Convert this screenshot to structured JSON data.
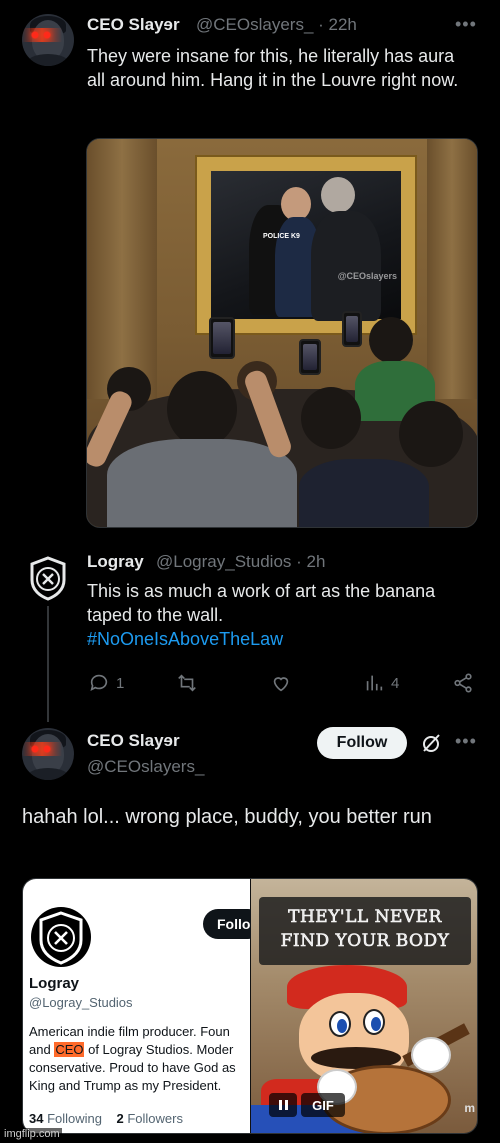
{
  "tweet1": {
    "name": "CEO Slayɘr",
    "handle": "@CEOslayers_",
    "time": "· 22h",
    "more": "•••",
    "text": "They were insane for this, he literally has aura all around him. Hang it in the Louvre right now.",
    "image": {
      "painting_police_text": "POLICE K9",
      "watermark": "@CEOslayers"
    }
  },
  "tweet2": {
    "name": "Logray",
    "handle": "@Logray_Studios",
    "time": "· 2h",
    "text_line1": "This is as much a work of art as the banana",
    "text_line2": "taped to the wall.",
    "hashtag": "#NoOneIsAboveTheLaw",
    "actions": {
      "reply_count": "1",
      "retweet_count": "",
      "like_count": "",
      "views_count": "4"
    }
  },
  "tweet3": {
    "name": "CEO Slayɘr",
    "handle": "@CEOslayers_",
    "follow_label": "Follow",
    "more": "•••",
    "text": "hahah lol... wrong place, buddy, you better run",
    "screenshot": {
      "follow_label": "Follo",
      "name": "Logray",
      "handle": "@Logray_Studios",
      "bio_line1": "American indie film producer. Foun",
      "bio_line2_pre": "and ",
      "bio_line2_hl": "CEO",
      "bio_line2_post": " of Logray Studios. Moder",
      "bio_line3": "conservative. Proud to have God as",
      "bio_line4": "King and Trump as my President.",
      "following_count": "34",
      "following_label": "Following",
      "followers_count": "2",
      "followers_label": "Followers"
    },
    "gif": {
      "caption_line1": "THEY'LL NEVER",
      "caption_line2": "FIND YOUR BODY",
      "badge": "GIF",
      "corner": "m"
    }
  },
  "watermark": "imgflip.com",
  "colors": {
    "background": "#000000",
    "text_primary": "#e7e9ea",
    "text_secondary": "#71767b",
    "link": "#1d9bf0",
    "follow_button_bg": "#eff3f4",
    "highlight": "#ff6a2a"
  }
}
